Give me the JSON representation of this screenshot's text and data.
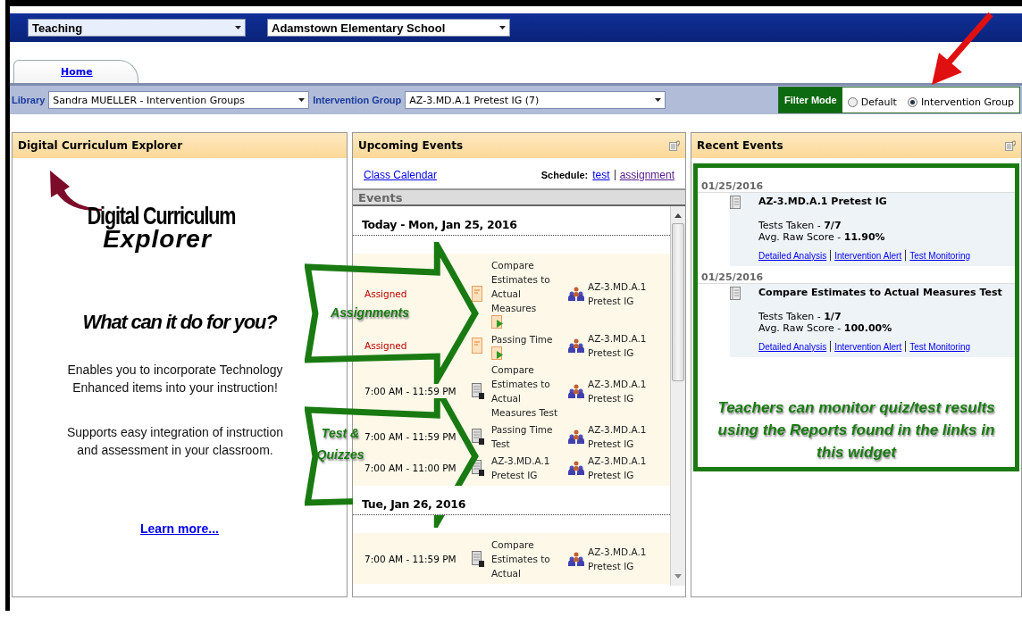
{
  "top_bar": {
    "role_select": {
      "value": "Teaching"
    },
    "school_select": {
      "value": "Adamstown Elementary School"
    }
  },
  "tabs": [
    {
      "label": "Home",
      "selected": true
    }
  ],
  "filter_bar": {
    "library_label": "Library",
    "library_select": {
      "value": "Sandra MUELLER - Intervention Groups"
    },
    "group_label": "Intervention Group",
    "group_select": {
      "value": "AZ-3.MD.A.1 Pretest IG (7)"
    },
    "filter_mode": {
      "label": "Filter Mode",
      "options": [
        {
          "label": "Default",
          "selected": false
        },
        {
          "label": "Intervention Group",
          "selected": true
        }
      ]
    }
  },
  "explorer_panel": {
    "title": "Digital Curriculum Explorer",
    "logo_line_1": "Digital Curriculum",
    "logo_line_2": "Explorer",
    "question": "What can it do for you?",
    "paragraphs": [
      "Enables you to incorporate Technology Enhanced items into your instruction!",
      "Supports easy integration of instruction and assessment in your classroom."
    ],
    "link": "Learn more..."
  },
  "upcoming_panel": {
    "title": "Upcoming Events",
    "calendar_link": "Class Calendar",
    "schedule_label": "Schedule:",
    "schedule_links": [
      "test",
      "assignment"
    ],
    "section": "Events",
    "days": [
      {
        "date": "Today - Mon, Jan 25, 2016",
        "events": [
          {
            "kind": "assignment",
            "when": "Assigned",
            "title": "Compare Estimates to Actual Measures",
            "group": "AZ-3.MD.A.1 Pretest IG"
          },
          {
            "kind": "assignment",
            "when": "Assigned",
            "title": "Passing Time",
            "group": "AZ-3.MD.A.1 Pretest IG"
          },
          {
            "kind": "test",
            "when": "7:00 AM - 11:59 PM",
            "title": "Compare Estimates to Actual Measures Test",
            "group": "AZ-3.MD.A.1 Pretest IG"
          },
          {
            "kind": "test",
            "when": "7:00 AM - 11:59 PM",
            "title": "Passing Time Test",
            "group": "AZ-3.MD.A.1 Pretest IG"
          },
          {
            "kind": "test",
            "when": "7:00 AM - 11:00 PM",
            "title": "AZ-3.MD.A.1 Pretest IG",
            "group": "AZ-3.MD.A.1 Pretest IG"
          }
        ]
      },
      {
        "date": "Tue, Jan 26, 2016",
        "events": [
          {
            "kind": "test",
            "when": "7:00 AM - 11:59 PM",
            "title": "Compare Estimates to Actual",
            "group": "AZ-3.MD.A.1 Pretest IG"
          }
        ]
      }
    ]
  },
  "recent_panel": {
    "title": "Recent Events",
    "items": [
      {
        "date": "01/25/2016",
        "title": "AZ-3.MD.A.1 Pretest IG",
        "tests": "Tests Taken - **7/7**",
        "score": "Avg. Raw Score - **11.90%**",
        "links": [
          "Detailed Analysis",
          "Intervention Alert",
          "Test Monitoring"
        ]
      },
      {
        "date": "01/25/2016",
        "title": "Compare Estimates to Actual Measures Test",
        "tests": "Tests Taken - **1/7**",
        "score": "Avg. Raw Score - **100.00%**",
        "links": [
          "Detailed Analysis",
          "Intervention Alert",
          "Test Monitoring"
        ]
      }
    ],
    "callout": "Teachers can monitor quiz/test results using the Reports found in the links in this widget"
  },
  "annotations": [
    {
      "kind": "arrow",
      "label": "Assignments"
    },
    {
      "kind": "arrow",
      "label": "Test &\nQuizzes"
    },
    {
      "kind": "pointer"
    }
  ]
}
